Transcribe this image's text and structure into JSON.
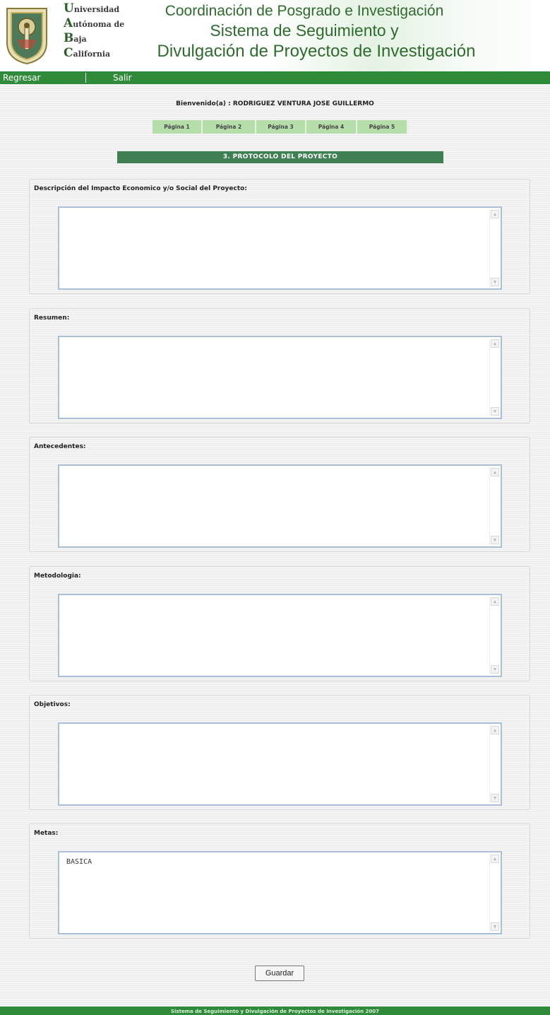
{
  "header": {
    "university_lines": [
      {
        "initial": "U",
        "rest": "niversidad"
      },
      {
        "initial": "A",
        "rest": "utónoma de"
      },
      {
        "initial": "B",
        "rest": "aja"
      },
      {
        "initial": "C",
        "rest": "alifornia"
      }
    ],
    "title_line1": "Coordinación de Posgrado e Investigación",
    "title_line2": "Sistema de Seguimiento y",
    "title_line3": "Divulgación de Proyectos de Investigación"
  },
  "nav": {
    "back_label": "Regresar",
    "logout_label": "Salir"
  },
  "welcome": "Bienvenido(a) : RODRIGUEZ VENTURA JOSE GUILLERMO",
  "pages": [
    "Página 1",
    "Página 2",
    "Página 3",
    "Página 4",
    "Página 5"
  ],
  "section_title": "3. PROTOCOLO DEL PROYECTO",
  "fields": [
    {
      "label": "Descripción del Impacto Economico y/o Social del Proyecto:",
      "value": ""
    },
    {
      "label": "Resumen:",
      "value": ""
    },
    {
      "label": "Antecedentes:",
      "value": ""
    },
    {
      "label": "Metodologia:",
      "value": ""
    },
    {
      "label": "Objetivos:",
      "value": ""
    },
    {
      "label": "Metas:",
      "value": "BASICA"
    }
  ],
  "save_label": "Guardar",
  "footer": "Sistema de Seguimiento y Divulgación de Proyectos de Investigación 2007",
  "colors": {
    "brand_green": "#2f8a3a",
    "section_green": "#3f7f52",
    "tab_green": "#b6deaa",
    "title_green": "#2f6b2f"
  }
}
